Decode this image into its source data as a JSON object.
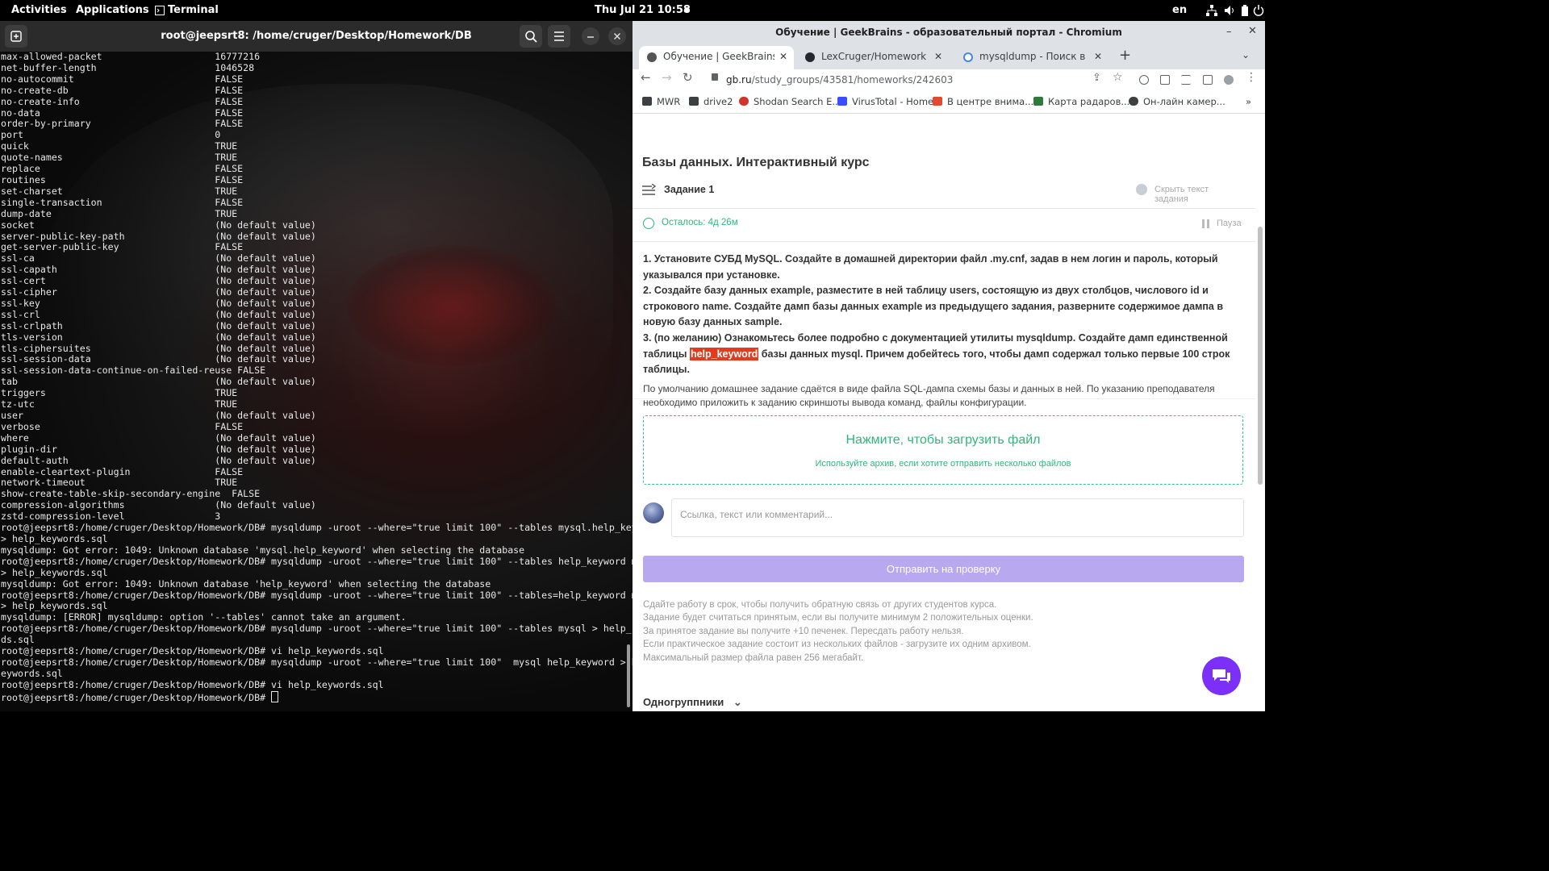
{
  "topbar": {
    "activities": "Activities",
    "applications": "Applications",
    "terminal_app": "Terminal",
    "clock": "Thu Jul 21  10:58",
    "lang": "en"
  },
  "terminal": {
    "title": "root@jeepsrt8: /home/cruger/Desktop/Homework/DB",
    "lines": [
      "max-allowed-packet                    16777216",
      "net-buffer-length                     1046528",
      "no-autocommit                         FALSE",
      "no-create-db                          FALSE",
      "no-create-info                        FALSE",
      "no-data                               FALSE",
      "order-by-primary                      FALSE",
      "port                                  0",
      "quick                                 TRUE",
      "quote-names                           TRUE",
      "replace                               FALSE",
      "routines                              FALSE",
      "set-charset                           TRUE",
      "single-transaction                    FALSE",
      "dump-date                             TRUE",
      "socket                                (No default value)",
      "server-public-key-path                (No default value)",
      "get-server-public-key                 FALSE",
      "ssl-ca                                (No default value)",
      "ssl-capath                            (No default value)",
      "ssl-cert                              (No default value)",
      "ssl-cipher                            (No default value)",
      "ssl-key                               (No default value)",
      "ssl-crl                               (No default value)",
      "ssl-crlpath                           (No default value)",
      "tls-version                           (No default value)",
      "tls-ciphersuites                      (No default value)",
      "ssl-session-data                      (No default value)",
      "ssl-session-data-continue-on-failed-reuse FALSE",
      "tab                                   (No default value)",
      "triggers                              TRUE",
      "tz-utc                                TRUE",
      "user                                  (No default value)",
      "verbose                               FALSE",
      "where                                 (No default value)",
      "plugin-dir                            (No default value)",
      "default-auth                          (No default value)",
      "enable-cleartext-plugin               FALSE",
      "network-timeout                       TRUE",
      "show-create-table-skip-secondary-engine  FALSE",
      "compression-algorithms                (No default value)",
      "zstd-compression-level                3",
      "root@jeepsrt8:/home/cruger/Desktop/Homework/DB# mysqldump -uroot --where=\"true limit 100\" --tables mysql.help_keyword",
      "> help_keywords.sql",
      "mysqldump: Got error: 1049: Unknown database 'mysql.help_keyword' when selecting the database",
      "root@jeepsrt8:/home/cruger/Desktop/Homework/DB# mysqldump -uroot --where=\"true limit 100\" --tables help_keyword mysql",
      "> help_keywords.sql",
      "mysqldump: Got error: 1049: Unknown database 'help_keyword' when selecting the database",
      "root@jeepsrt8:/home/cruger/Desktop/Homework/DB# mysqldump -uroot --where=\"true limit 100\" --tables=help_keyword mysql",
      "> help_keywords.sql",
      "mysqldump: [ERROR] mysqldump: option '--tables' cannot take an argument.",
      "root@jeepsrt8:/home/cruger/Desktop/Homework/DB# mysqldump -uroot --where=\"true limit 100\" --tables mysql > help_keywor",
      "ds.sql",
      "root@jeepsrt8:/home/cruger/Desktop/Homework/DB# vi help_keywords.sql",
      "root@jeepsrt8:/home/cruger/Desktop/Homework/DB# mysqldump -uroot --where=\"true limit 100\"  mysql help_keyword > help_k",
      "eywords.sql",
      "root@jeepsrt8:/home/cruger/Desktop/Homework/DB# vi help_keywords.sql"
    ],
    "prompt": "root@jeepsrt8:/home/cruger/Desktop/Homework/DB# "
  },
  "browser": {
    "window_title": "Обучение | GeekBrains - образовательный портал - Chromium",
    "tabs": [
      {
        "label": "Обучение | GeekBrains - образ",
        "active": true,
        "favicon_color": "#555555"
      },
      {
        "label": "LexCruger/Homework",
        "active": false,
        "favicon_color": "#24292f"
      },
      {
        "label": "mysqldump - Поиск в Google",
        "active": false,
        "favicon_color": "#4285f4"
      }
    ],
    "url_host": "gb.ru",
    "url_path": "/study_groups/43581/homeworks/242603",
    "bookmarks": [
      {
        "label": "MWR",
        "color": "#3c4043"
      },
      {
        "label": "drive2",
        "color": "#3c4043"
      },
      {
        "label": "Shodan Search E...",
        "color": "#d0342c"
      },
      {
        "label": "VirusTotal - Home",
        "color": "#394eff"
      },
      {
        "label": "В центре внима...",
        "color": "#e04b2f"
      },
      {
        "label": "Карта радаров...",
        "color": "#2d7a3c"
      },
      {
        "label": "Он-лайн камер...",
        "color": "#3c4043"
      }
    ]
  },
  "page": {
    "course_title": "Базы данных. Интерактивный курс",
    "task_label": "Задание 1",
    "hide_task": "Скрыть текст задания",
    "remaining": "Осталось: 4д 26м",
    "pause": "Пауза",
    "task_p1": "1. Установите СУБД MySQL. Создайте в домашней директории файл .my.cnf, задав в нем логин и пароль, который указывался при установке.",
    "task_p2": "2. Создайте базу данных example, разместите в ней таблицу users, состоящую из двух столбцов, числового id и строкового name. Создайте дамп базы данных example из предыдущего задания, разверните содержимое дампа в новую базу данных sample.",
    "task_p3_pre": "3. (по желанию) Ознакомьтесь более подробно с документацией утилиты mysqldump. Создайте дамп единственной таблицы ",
    "task_p3_kw": "help_keyword",
    "task_p3_post": " базы данных mysql. Причем добейтесь того, чтобы дамп содержал только первые 100 строк таблицы.",
    "task_note": "По умолчанию домашнее задание сдаётся в виде файла SQL-дампа схемы базы и данных в ней. По указанию преподавателя необходимо приложить к заданию скриншоты вывода команд, файлы конфигурации.",
    "upload_title": "Нажмите, чтобы загрузить файл",
    "upload_hint": "Используйте архив, если хотите отправить несколько файлов",
    "comment_placeholder": "Ссылка, текст или комментарий...",
    "submit_label": "Отправить на проверку",
    "notes": [
      "Сдайте работу в срок, чтобы получить обратную связь от других студентов курса.",
      "Задание будет считаться принятым, если вы получите минимум 2 положительных оценки.",
      "За принятое задание вы получите +10 печенек. Пересдать работу нельзя.",
      "Если практическое задание состоит из нескольких файлов - загрузите их одним архивом.",
      "Максимальный размер файла равен 256 мегабайт."
    ],
    "classmates": "Одногруппники",
    "accent": "#2fb77a",
    "submit_color": "#b7a8f0",
    "chat_color": "#7b2ff7"
  }
}
